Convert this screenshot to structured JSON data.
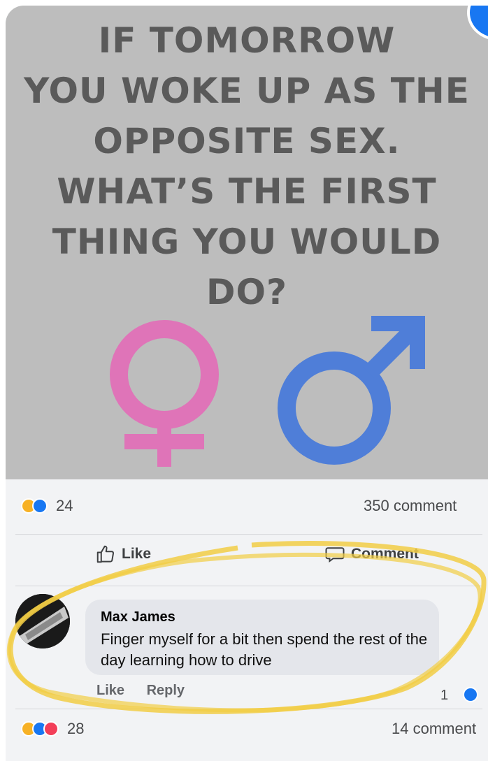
{
  "post": {
    "headline": [
      "IF TOMORROW",
      "YOU WOKE UP AS THE",
      "OPPOSITE SEX.",
      "WHAT’S THE FIRST",
      "THING YOU WOULD",
      "DO?"
    ],
    "colors": {
      "female": "#df74b8",
      "male": "#4f7ed8",
      "highlight": "#f2cd45"
    }
  },
  "stats": {
    "reactions_count": "24",
    "comments_count": "350 comment"
  },
  "actions": {
    "like": "Like",
    "comment": "Comment"
  },
  "comment": {
    "author": "Max James",
    "text": "Finger myself for a bit then spend the rest of the day learning how to drive",
    "like": "Like",
    "reply": "Reply",
    "reaction_count": "1"
  },
  "footer": {
    "reactions_count": "28",
    "comments_count": "14 comment"
  }
}
